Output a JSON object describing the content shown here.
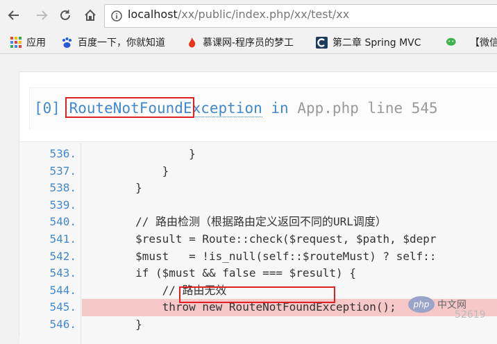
{
  "browser": {
    "url_host": "localhost",
    "url_path": "/xx/public/index.php/xx/test/xx"
  },
  "bookmarks": [
    {
      "label": "应用",
      "icon": "apps-grid-icon"
    },
    {
      "label": "百度一下，你就知道",
      "icon": "baidu-paw-icon"
    },
    {
      "label": "慕课网-程序员的梦工",
      "icon": "imooc-flame-icon"
    },
    {
      "label": "第二章 Spring MVC",
      "icon": "site-c-icon"
    },
    {
      "label": "【微信",
      "icon": "wechat-icon"
    }
  ],
  "exception": {
    "index": "[0]",
    "class_name": "RouteNotFoundException",
    "in_text": "in",
    "file": "App.php",
    "line_text": "line 545"
  },
  "code_lines": [
    {
      "num": "536.",
      "text": "                }"
    },
    {
      "num": "537.",
      "text": "            }"
    },
    {
      "num": "538.",
      "text": "        }"
    },
    {
      "num": "539.",
      "text": ""
    },
    {
      "num": "540.",
      "text": "        // 路由检测（根据路由定义返回不同的URL调度）"
    },
    {
      "num": "541.",
      "text": "        $result = Route::check($request, $path, $depr"
    },
    {
      "num": "542.",
      "text": "        $must   = !is_null(self::$routeMust) ? self::"
    },
    {
      "num": "543.",
      "text": "        if ($must && false === $result) {"
    },
    {
      "num": "544.",
      "text": "            // 路由无效"
    },
    {
      "num": "545.",
      "text": "            throw new RouteNotFoundException();"
    },
    {
      "num": "546.",
      "text": "        }"
    }
  ],
  "active_line": "545.",
  "watermark": {
    "logo": "php",
    "text": "中文网",
    "id": "52619"
  }
}
